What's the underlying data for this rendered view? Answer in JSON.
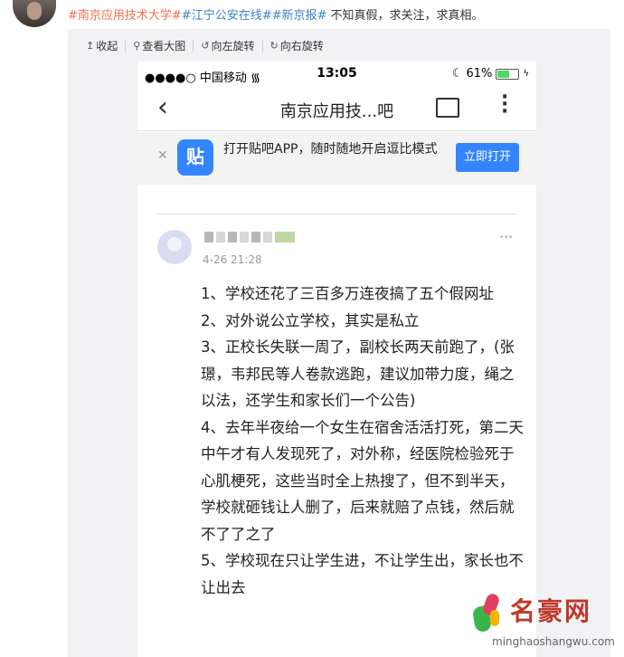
{
  "post": {
    "hashtag1": "#南京应用技术大学#",
    "hashtag2": "#江宁公安在线#",
    "hashtag3": "#新京报#",
    "text": " 不知真假，求关注，求真相。"
  },
  "toolbar": {
    "collapse": "收起",
    "view_large": "查看大图",
    "rotate_left": "向左旋转",
    "rotate_right": "向右旋转"
  },
  "phone": {
    "status": {
      "carrier": "●●●●○ 中国移动",
      "time": "13:05",
      "battery": "61%",
      "battery_level": 0.61
    },
    "nav": {
      "title": "南京应用技...吧"
    },
    "banner": {
      "logo": "贴",
      "text": "打开贴吧APP，随时随地开启逗比模式",
      "open_button": "立即打开"
    },
    "post": {
      "time": "4-26 21:28",
      "lines": [
        "1、学校还花了三百多万连夜搞了五个假网址",
        "2、对外说公立学校，其实是私立",
        "3、正校长失联一周了，副校长两天前跑了，(张璟，韦邦民等人卷款逃跑，建议加带力度，绳之以法，还学生和家长们一个公告)",
        "4、去年半夜给一个女生在宿舍活活打死，第二天中午才有人发现死了，对外称，经医院检验死于心肌梗死，这些当时全上热搜了，但不到半天，学校就砸钱让人删了，后来就赔了点钱，然后就不了了之了",
        "5、学校现在只让学生进，不让学生出，家长也不让出去"
      ]
    }
  },
  "watermark": {
    "name": "名豪网",
    "url": "minghaoshangwu.com"
  }
}
